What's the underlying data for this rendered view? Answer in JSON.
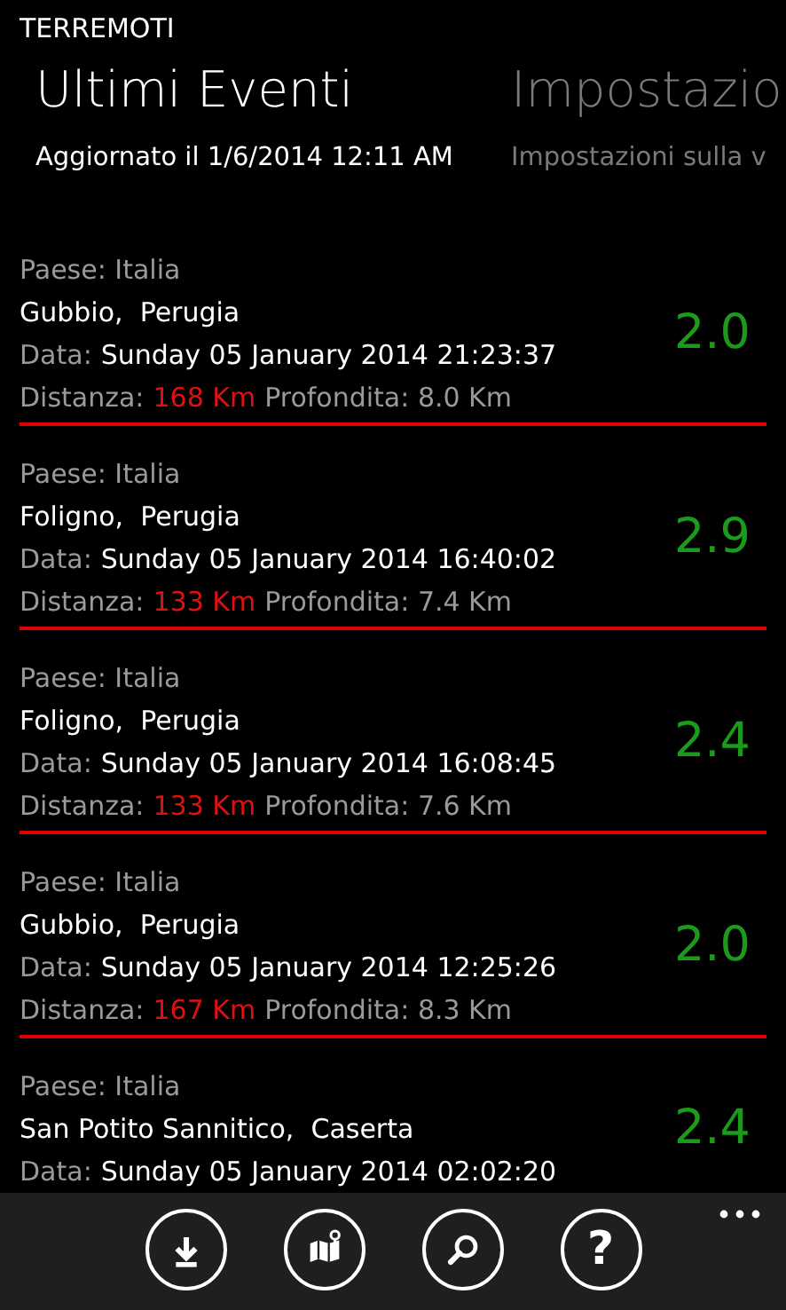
{
  "app_title": "TERREMOTI",
  "pivots": [
    {
      "title": "Ultimi Eventi",
      "subtitle": "Aggiornato il 1/6/2014 12:11 AM",
      "selected": true
    },
    {
      "title": "Impostazio",
      "subtitle": "Impostazioni sulla v",
      "selected": false
    }
  ],
  "events": [
    {
      "country": "Paese: Italia",
      "place": "Gubbio,  Perugia",
      "date_label": "Data:",
      "date": "Sunday 05 January 2014 21:23:37",
      "distance_label": "Distanza:",
      "distance": "168 Km",
      "depth": "Profondita: 8.0 Km",
      "magnitude": "2.0"
    },
    {
      "country": "Paese: Italia",
      "place": "Foligno,  Perugia",
      "date_label": "Data:",
      "date": "Sunday 05 January 2014 16:40:02",
      "distance_label": "Distanza:",
      "distance": "133 Km",
      "depth": "Profondita: 7.4 Km",
      "magnitude": "2.9"
    },
    {
      "country": "Paese: Italia",
      "place": "Foligno,  Perugia",
      "date_label": "Data:",
      "date": "Sunday 05 January 2014 16:08:45",
      "distance_label": "Distanza:",
      "distance": "133 Km",
      "depth": "Profondita: 7.6 Km",
      "magnitude": "2.4"
    },
    {
      "country": "Paese: Italia",
      "place": "Gubbio,  Perugia",
      "date_label": "Data:",
      "date": "Sunday 05 January 2014 12:25:26",
      "distance_label": "Distanza:",
      "distance": "167 Km",
      "depth": "Profondita: 8.3 Km",
      "magnitude": "2.0"
    },
    {
      "country": "Paese: Italia",
      "place": "San Potito Sannitico,  Caserta",
      "date_label": "Data:",
      "date": "Sunday 05 January 2014 02:02:20",
      "magnitude": "2.4"
    }
  ],
  "app_bar": {
    "buttons": [
      {
        "kind": "download"
      },
      {
        "kind": "map"
      },
      {
        "kind": "search"
      },
      {
        "kind": "help",
        "glyph": "?"
      }
    ]
  }
}
